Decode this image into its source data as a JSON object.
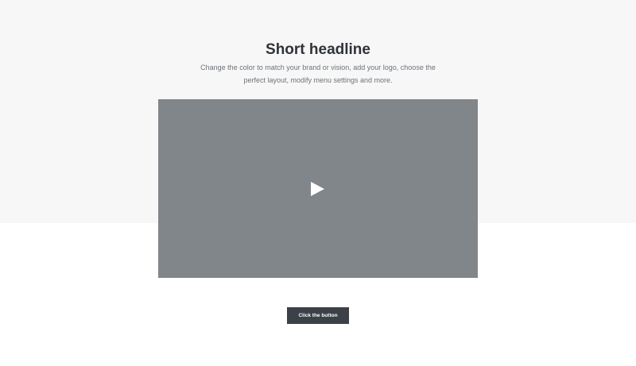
{
  "hero": {
    "headline": "Short headline",
    "description_line1": "Change the color to match your brand or vision, add your logo, choose the",
    "description_line2": "perfect layout, modify menu settings and more."
  },
  "video": {
    "play_icon": "play-icon"
  },
  "cta": {
    "label": "Click the button"
  },
  "colors": {
    "top_band": "#f7f7f7",
    "video_placeholder": "#81868b",
    "button": "#3b4147",
    "headline": "#2f3338",
    "body_text": "#6c737a"
  }
}
